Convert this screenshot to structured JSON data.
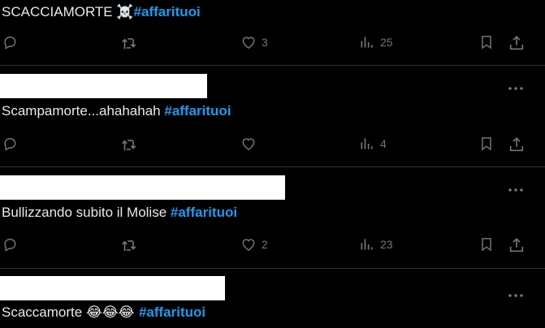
{
  "colors": {
    "background": "#000000",
    "text": "#e7e9ea",
    "muted": "#71767b",
    "hashtag": "#1d9bf0",
    "divider": "#2f3336"
  },
  "tweets": [
    {
      "text": "SCACCIAMORTE ",
      "emoji": "☠️",
      "hashtag": "#affarituoi",
      "likes": "3",
      "views": "25"
    },
    {
      "text": "Scampamorte...ahahahah ",
      "emoji": "",
      "hashtag": "#affarituoi",
      "likes": "",
      "views": "4"
    },
    {
      "text": "Bullizzando subito il Molise ",
      "emoji": "",
      "hashtag": "#affarituoi",
      "likes": "2",
      "views": "23"
    },
    {
      "text": "Scaccamorte ",
      "emoji": "😂😂😂 ",
      "hashtag": "#affarituoi"
    }
  ],
  "icons": {
    "reply": "reply-icon",
    "retweet": "retweet-icon",
    "like": "heart-icon",
    "views": "views-icon",
    "bookmark": "bookmark-icon",
    "share": "share-icon",
    "more": "more-icon"
  }
}
